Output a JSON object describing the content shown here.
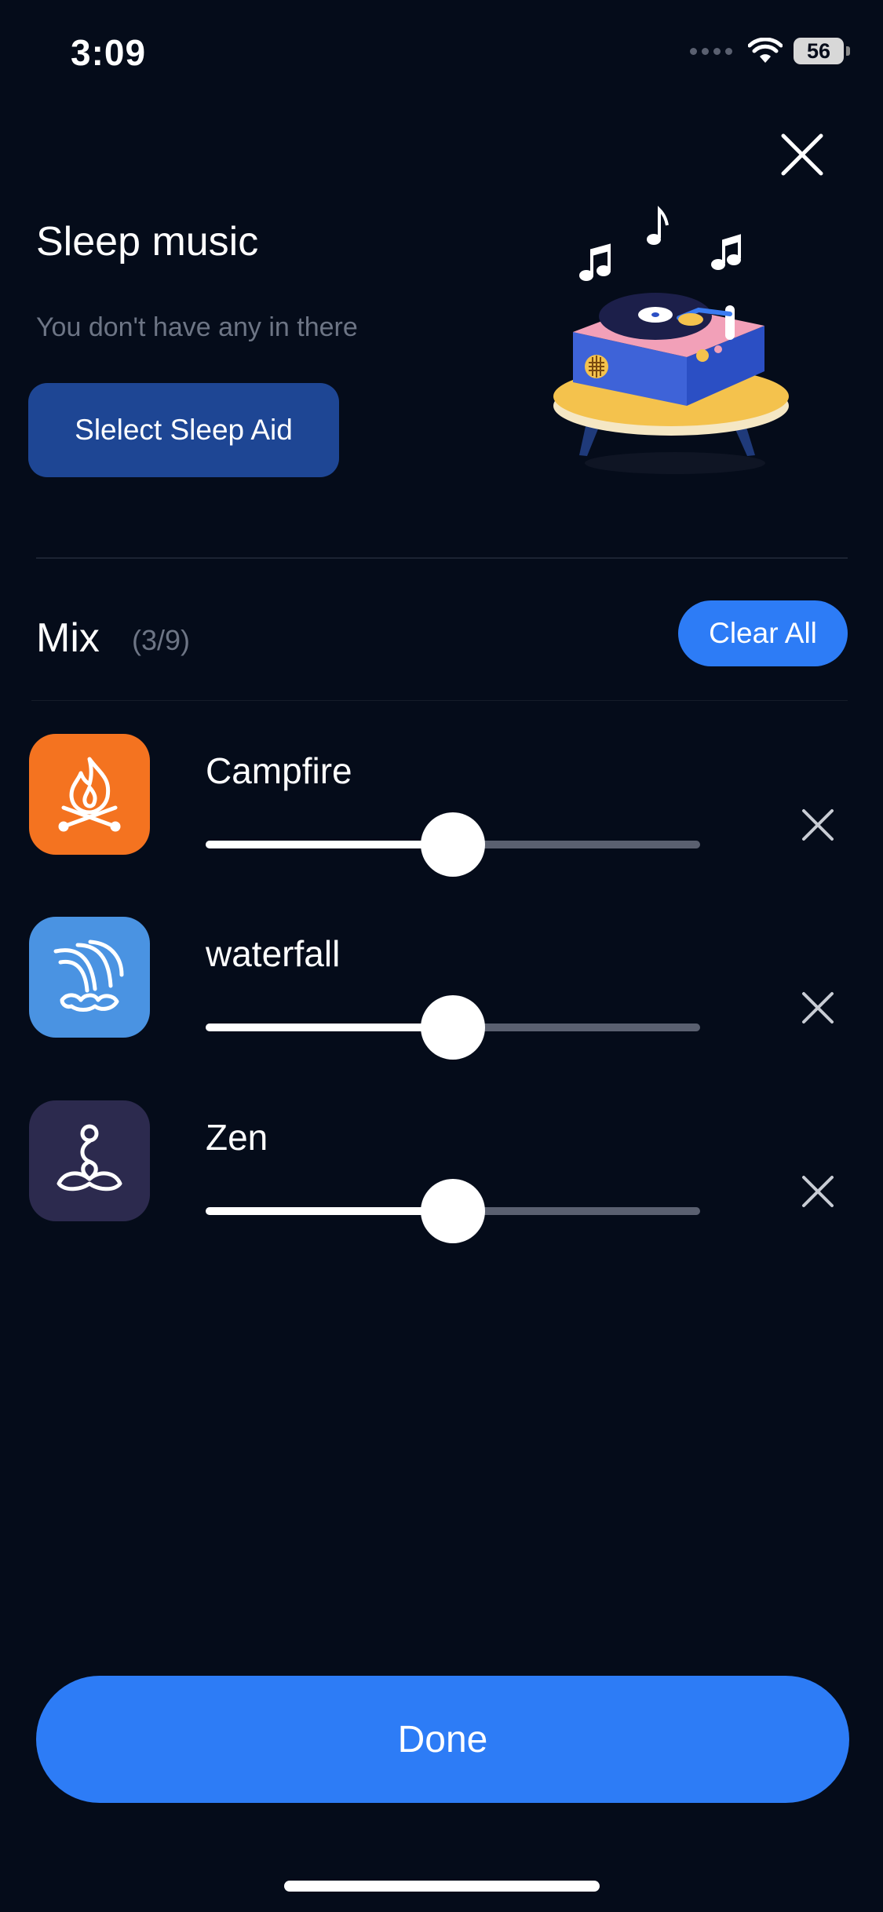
{
  "status_bar": {
    "time": "3:09",
    "battery": "56"
  },
  "sleep_music": {
    "title": "Sleep music",
    "subtitle": "You don't have any in there",
    "select_button": "Slelect Sleep Aid"
  },
  "mix": {
    "title": "Mix",
    "count": "(3/9)",
    "clear_all": "Clear All",
    "sounds": [
      {
        "name": "Campfire",
        "icon": "campfire-icon",
        "color": "#f47320",
        "volume": 0.5
      },
      {
        "name": "waterfall",
        "icon": "waterfall-icon",
        "color": "#4a93e2",
        "volume": 0.5
      },
      {
        "name": "Zen",
        "icon": "zen-meditation-icon",
        "color": "#2c2a4e",
        "volume": 0.5
      }
    ]
  },
  "done_button": "Done",
  "colors": {
    "background": "#050c1a",
    "accent": "#2d7cf6",
    "select_button": "#1e4694"
  }
}
